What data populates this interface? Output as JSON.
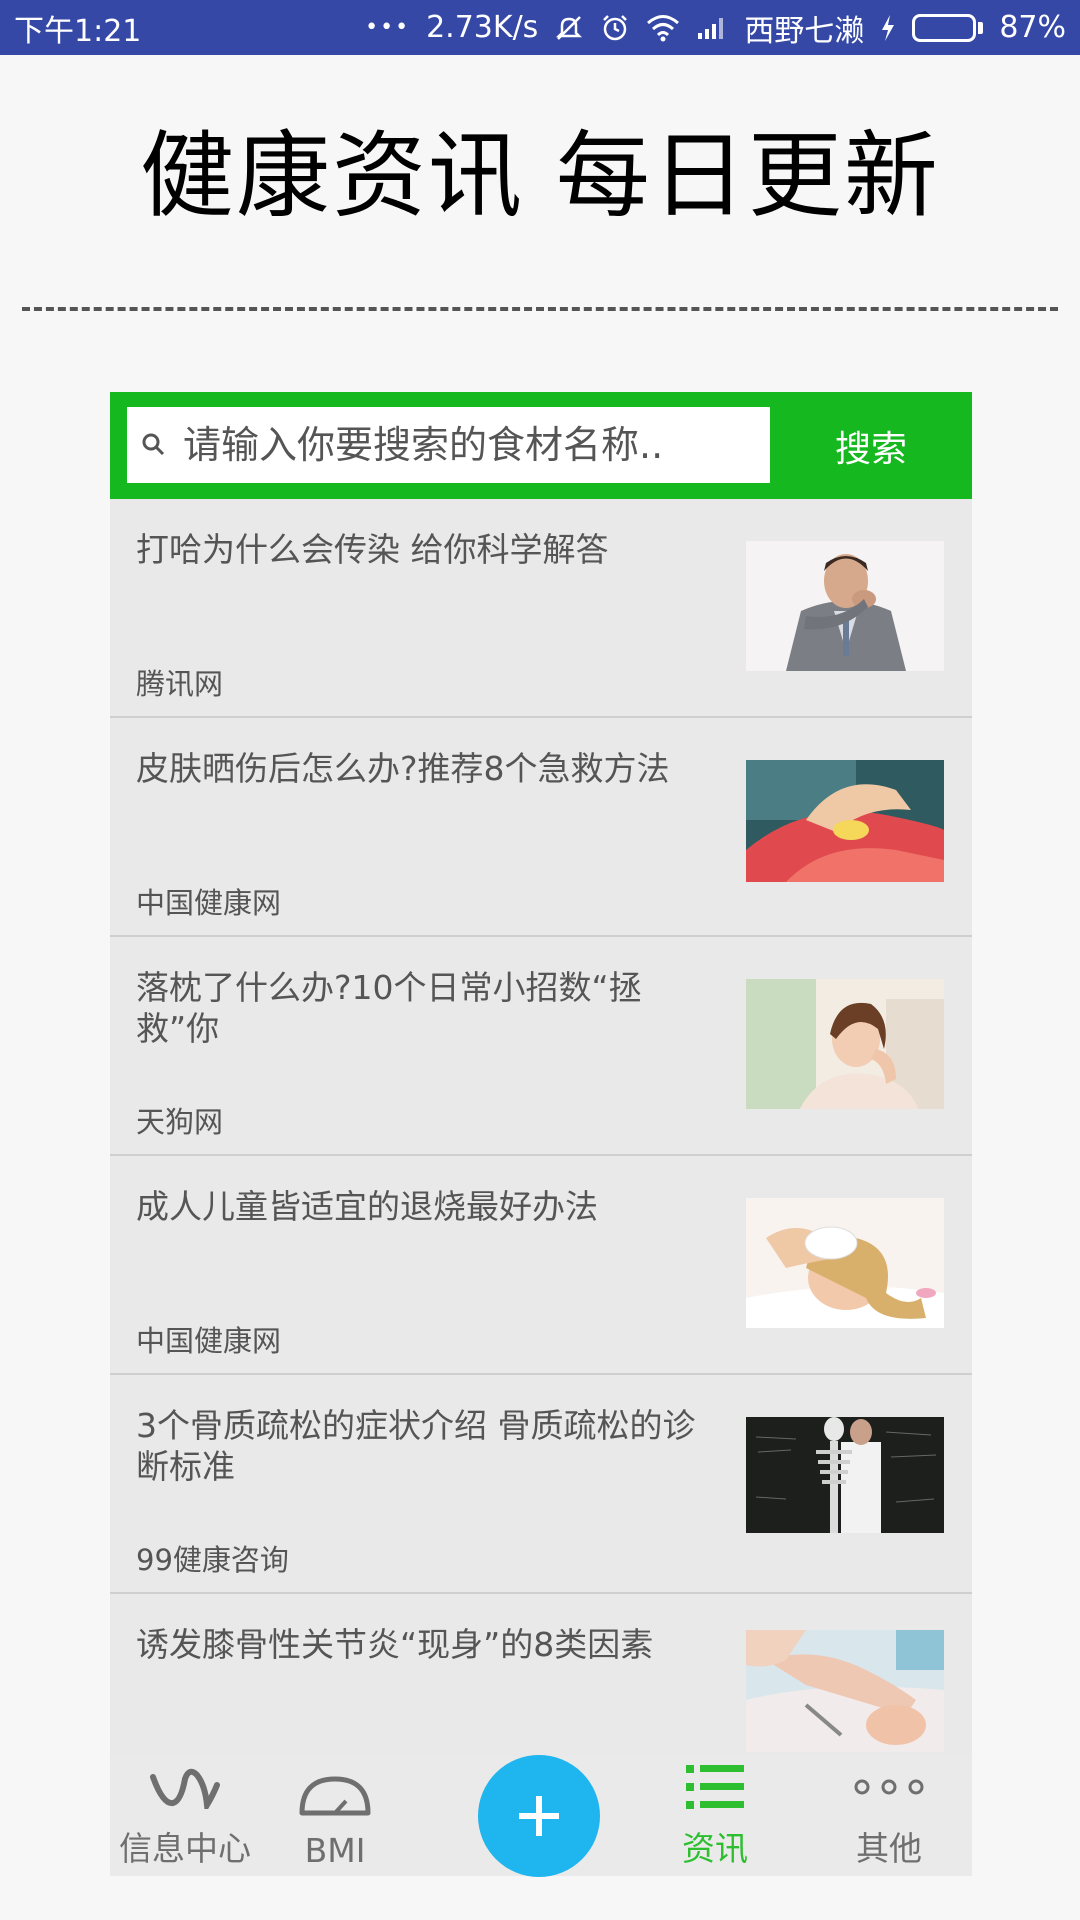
{
  "status_bar": {
    "time": "下午1:21",
    "dots": "•••",
    "network_speed": "2.73K/s",
    "carrier": "西野七濑",
    "battery": "87%",
    "battery_level": 0.87,
    "background": "#3548a6"
  },
  "header": {
    "title": "健康资讯 每日更新"
  },
  "search": {
    "placeholder": "请输入你要搜索的食材名称..",
    "button_label": "搜索",
    "accent_color": "#16b81f"
  },
  "news": [
    {
      "title": "打哈为什么会传染 给你科学解答",
      "source": "腾讯网",
      "image": "man-yawning"
    },
    {
      "title": "皮肤晒伤后怎么办?推荐8个急救方法",
      "source": "中国健康网",
      "image": "sunburn-cream"
    },
    {
      "title": "落枕了什么办?10个日常小招数“拯救”你",
      "source": "天狗网",
      "image": "woman-neck"
    },
    {
      "title": "成人儿童皆适宜的退烧最好办法",
      "source": "中国健康网",
      "image": "child-fever"
    },
    {
      "title": "3个骨质疏松的症状介绍 骨质疏松的诊断标准",
      "source": "99健康咨询",
      "image": "skeleton-blackboard"
    },
    {
      "title": "诱发膝骨性关节炎“现身”的8类因素",
      "source": "",
      "image": "knee-exam"
    }
  ],
  "bottom_nav": {
    "items": [
      {
        "label": "信息中心",
        "icon": "wave-icon",
        "active": false
      },
      {
        "label": "BMI",
        "icon": "gauge-icon",
        "active": false
      },
      {
        "label": "资讯",
        "icon": "list-icon",
        "active": true
      },
      {
        "label": "其他",
        "icon": "more-dots-icon",
        "active": false
      }
    ],
    "fab_icon": "plus-icon",
    "fab_color": "#1fb5ee",
    "active_color": "#2dbf2f"
  }
}
